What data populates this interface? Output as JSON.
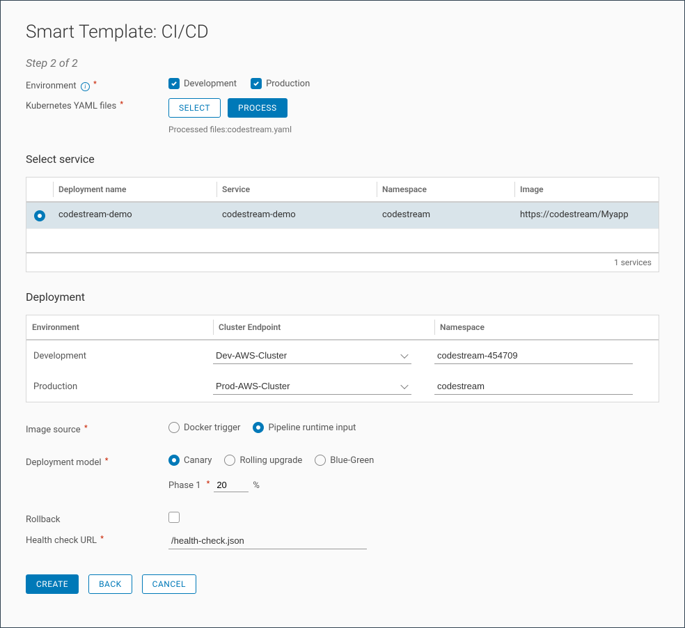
{
  "page_title": "Smart Template: CI/CD",
  "step_indicator": "Step 2 of 2",
  "labels": {
    "environment": "Environment",
    "k8s_yaml": "Kubernetes YAML files",
    "select_service": "Select service",
    "deployment": "Deployment",
    "image_source": "Image source",
    "deployment_model": "Deployment model",
    "rollback": "Rollback",
    "health_check_url": "Health check URL",
    "phase1": "Phase 1",
    "percent": "%"
  },
  "environment_options": {
    "development": {
      "label": "Development",
      "checked": true
    },
    "production": {
      "label": "Production",
      "checked": true
    }
  },
  "yaml": {
    "select_btn": "SELECT",
    "process_btn": "PROCESS",
    "processed_text": "Processed files:codestream.yaml"
  },
  "service_table": {
    "headers": {
      "deployment_name": "Deployment name",
      "service": "Service",
      "namespace": "Namespace",
      "image": "Image"
    },
    "rows": [
      {
        "selected": true,
        "deployment_name": "codestream-demo",
        "service": "codestream-demo",
        "namespace": "codestream",
        "image": "https://codestream/Myapp"
      }
    ],
    "footer": "1 services"
  },
  "deploy_table": {
    "headers": {
      "environment": "Environment",
      "cluster": "Cluster Endpoint",
      "namespace": "Namespace"
    },
    "rows": [
      {
        "environment": "Development",
        "cluster": "Dev-AWS-Cluster",
        "namespace": "codestream-454709"
      },
      {
        "environment": "Production",
        "cluster": "Prod-AWS-Cluster",
        "namespace": "codestream"
      }
    ]
  },
  "image_source": {
    "docker_trigger": {
      "label": "Docker trigger",
      "selected": false
    },
    "pipeline_runtime": {
      "label": "Pipeline runtime input",
      "selected": true
    }
  },
  "deployment_model": {
    "canary": {
      "label": "Canary",
      "selected": true
    },
    "rolling": {
      "label": "Rolling upgrade",
      "selected": false
    },
    "blue_green": {
      "label": "Blue-Green",
      "selected": false
    },
    "phase1_value": "20"
  },
  "rollback_checked": false,
  "health_check_value": "/health-check.json",
  "actions": {
    "create": "CREATE",
    "back": "BACK",
    "cancel": "CANCEL"
  }
}
